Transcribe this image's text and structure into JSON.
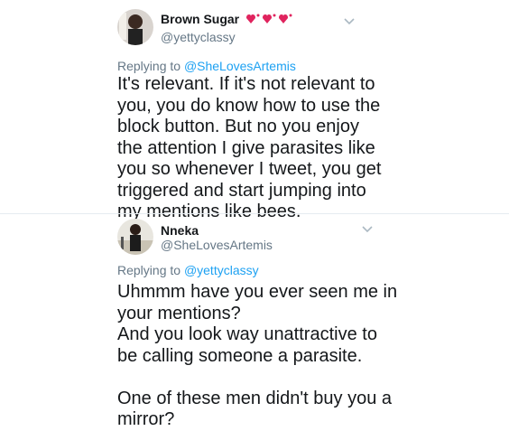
{
  "tweet1": {
    "display_name": "Brown Sugar",
    "name_emoji": "heart-decor-icon",
    "handle": "@yettyclassy",
    "replying_prefix": "Replying to ",
    "replying_to": "@SheLovesArtemis",
    "text": "It's relevant. If it's not relevant to\nyou, you do know how to use the\nblock button. But no you enjoy\nthe attention I give parasites like\nyou so whenever I tweet, you get\ntriggered and start jumping into\nmy mentions like bees."
  },
  "tweet2": {
    "display_name": "Nneka",
    "handle": "@SheLovesArtemis",
    "replying_prefix": "Replying to ",
    "replying_to": "@yettyclassy",
    "text": "Uhmmm have you ever seen me in\nyour mentions?\nAnd you look way unattractive to\nbe calling someone a parasite.\n\nOne of these men didn't buy you a\nmirror?"
  },
  "colors": {
    "text": "#14171a",
    "secondary": "#657786",
    "link": "#1da1f2",
    "heart": "#e0245e"
  }
}
